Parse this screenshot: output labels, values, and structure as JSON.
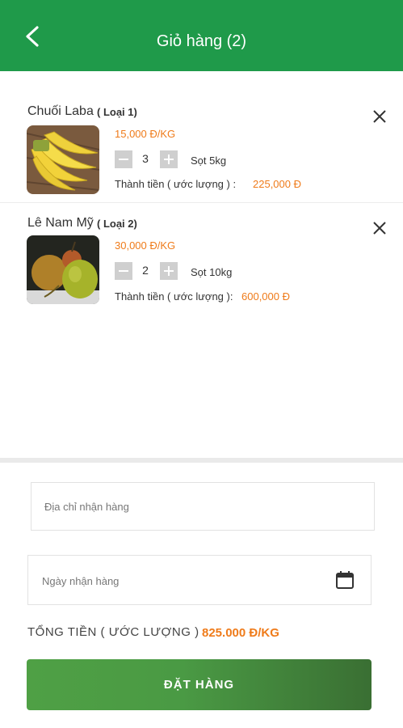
{
  "header": {
    "title": "Giỏ hàng (2)"
  },
  "cart": {
    "items": [
      {
        "name": "Chuối Laba",
        "type": "( Loại 1)",
        "price": "15,000 Đ/KG",
        "quantity": "3",
        "pack": "Sọt 5kg",
        "total_label": "Thành tiền ( ước lượng ) :",
        "total": "225,000 Đ",
        "image": "bananas"
      },
      {
        "name": "Lê Nam Mỹ",
        "type": "( Loại 2)",
        "price": "30,000 Đ/KG",
        "quantity": "2",
        "pack": "Sọt 10kg",
        "total_label": "Thành tiền ( ước lượng ):",
        "total": "600,000 Đ",
        "image": "pears"
      }
    ]
  },
  "form": {
    "address_placeholder": "Địa chỉ nhận hàng",
    "date_placeholder": "Ngày nhận hàng"
  },
  "summary": {
    "label": "TỔNG TIỀN ( ƯỚC LƯỢNG )",
    "value": "825.000 Đ/KG"
  },
  "actions": {
    "order_label": "ĐẶT HÀNG"
  },
  "colors": {
    "header": "#1f9a4a",
    "accent": "#ef7b1a",
    "button_start": "#4fa045",
    "button_end": "#3a6f33"
  }
}
